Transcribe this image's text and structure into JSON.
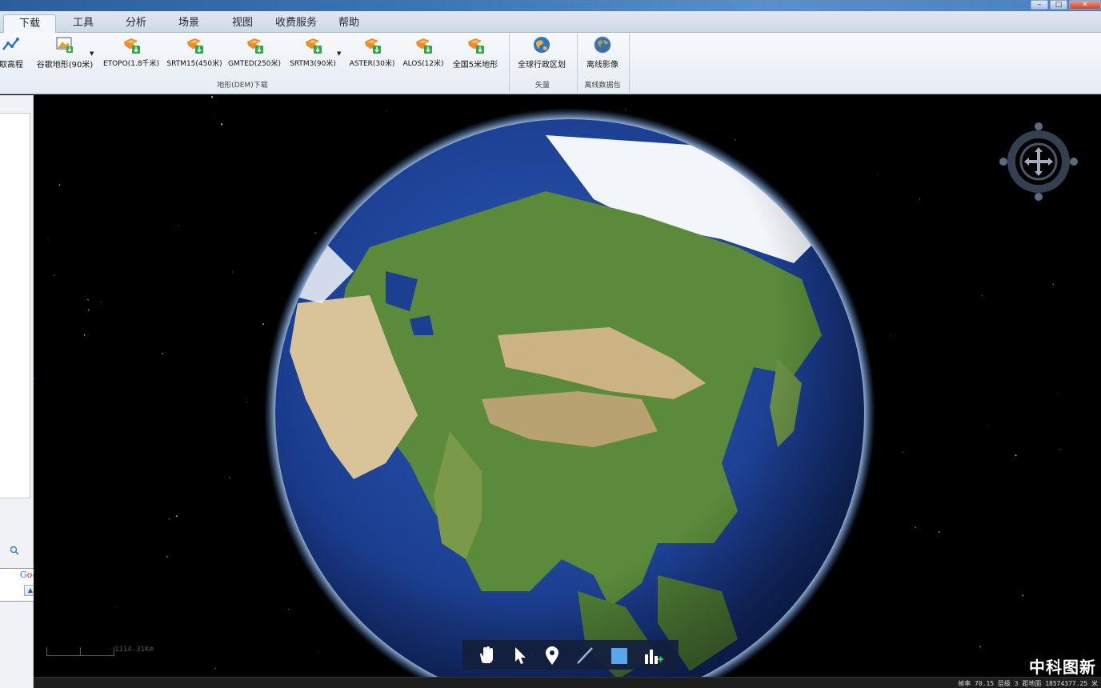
{
  "window": {
    "controls": [
      "–",
      "□",
      "✕"
    ]
  },
  "tabs": [
    {
      "label": "下载",
      "active": true
    },
    {
      "label": "工具"
    },
    {
      "label": "分析"
    },
    {
      "label": "场景"
    },
    {
      "label": "视图"
    },
    {
      "label": "收费服务"
    },
    {
      "label": "帮助"
    }
  ],
  "ribbon": {
    "buttons": [
      {
        "label": "取高程",
        "icon": "elevation-chart-icon"
      },
      {
        "label": "谷歌地形(90米)",
        "icon": "terrain-image-icon",
        "has_dropdown": true
      },
      {
        "label": "ETOPO(1.8千米)",
        "icon": "dem-download-icon"
      },
      {
        "label": "SRTM15(450米)",
        "icon": "dem-download-icon"
      },
      {
        "label": "GMTED(250米)",
        "icon": "dem-download-icon"
      },
      {
        "label": "SRTM3(90米)",
        "icon": "dem-download-icon",
        "has_dropdown": true
      },
      {
        "label": "ASTER(30米)",
        "icon": "dem-download-icon"
      },
      {
        "label": "ALOS(12米)",
        "icon": "dem-download-icon"
      },
      {
        "label": "全国5米地形",
        "icon": "dem-download-icon"
      },
      {
        "label": "全球行政区划",
        "icon": "globe-vector-icon"
      },
      {
        "label": "离线影像",
        "icon": "earth-offline-icon"
      }
    ],
    "groups": [
      {
        "label": "地形(DEM)下载"
      },
      {
        "label": "矢量"
      },
      {
        "label": "离线数据包"
      }
    ]
  },
  "sidebar": {
    "google_label": "Google",
    "search_icon": "search-icon"
  },
  "map": {
    "scale_label": "1114.31Km",
    "brand": "中科图新",
    "toolbar": [
      {
        "icon": "hand-pan-icon"
      },
      {
        "icon": "pointer-select-icon"
      },
      {
        "icon": "placemark-pin-icon"
      },
      {
        "icon": "line-draw-icon"
      },
      {
        "icon": "polygon-square-icon"
      },
      {
        "icon": "chart-add-icon"
      }
    ]
  },
  "status": {
    "text": "帧率 70.15  层级 3  距地面 18574377.25 米"
  },
  "colors": {
    "ocean": "#1c3f92",
    "land_green": "#5a8a3a",
    "desert": "#cbb384",
    "ice": "#f2f6fa",
    "atmosphere": "#9cc8ff"
  }
}
